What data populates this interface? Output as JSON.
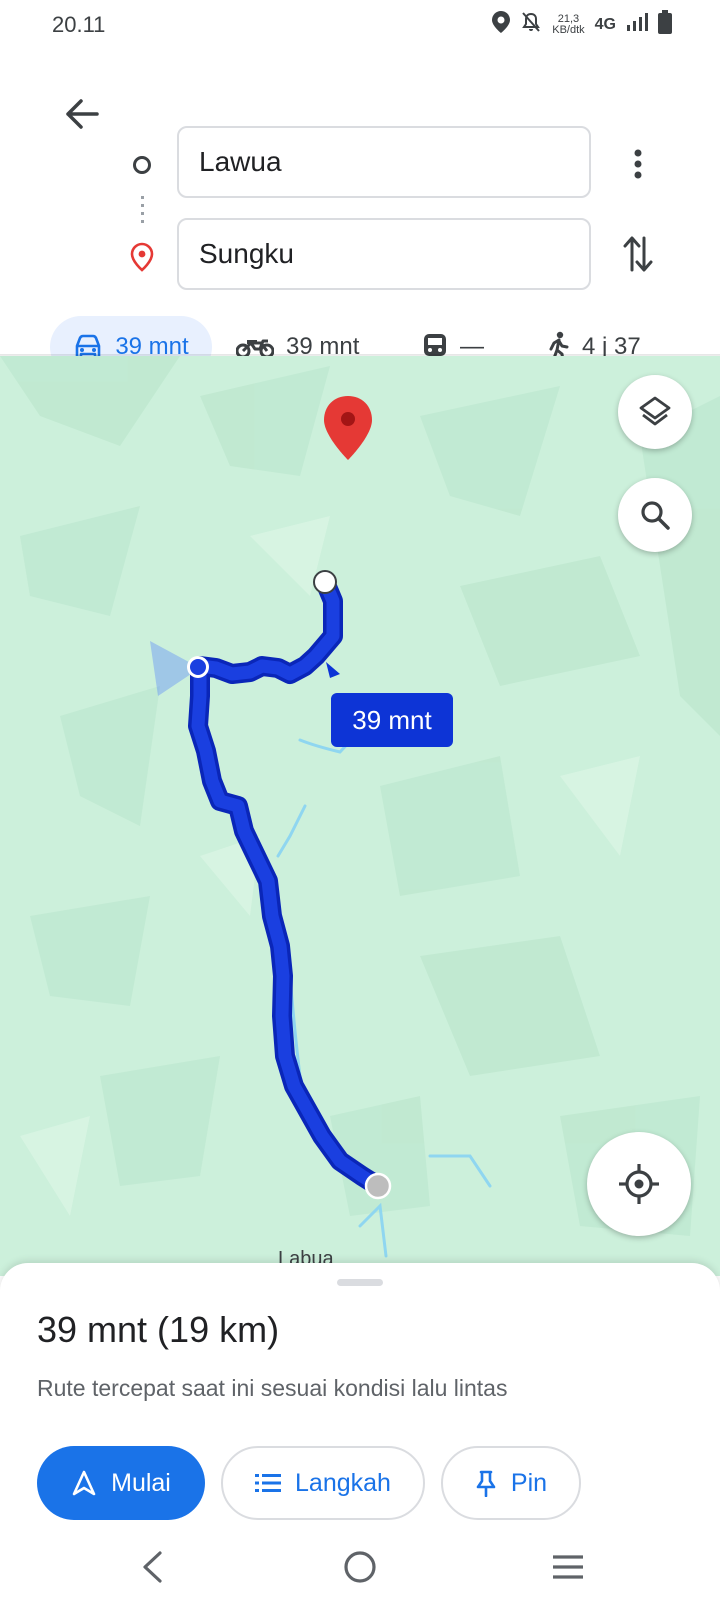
{
  "status_bar": {
    "time": "20.11",
    "speed_value": "21,3",
    "speed_unit": "KB/dtk",
    "network": "4G",
    "icons": [
      "location-icon",
      "mute-icon",
      "signal-icon",
      "battery-icon"
    ]
  },
  "directions": {
    "origin": "Lawua",
    "destination": "Sungku",
    "icons": [
      "back-arrow-icon",
      "origin-circle-icon",
      "destination-pin-icon",
      "more-vert-icon",
      "swap-icon"
    ]
  },
  "modes": [
    {
      "name": "car",
      "label": "39 mnt",
      "selected": true,
      "icon": "car-icon"
    },
    {
      "name": "motorcycle",
      "label": "39 mnt",
      "selected": false,
      "icon": "motorcycle-icon"
    },
    {
      "name": "transit",
      "label": "—",
      "selected": false,
      "icon": "train-icon"
    },
    {
      "name": "walk",
      "label": "4 j 37",
      "selected": false,
      "icon": "walk-icon"
    }
  ],
  "map": {
    "route_label": "39 mnt",
    "town_label": "Labua",
    "controls": [
      "layers-icon",
      "search-icon",
      "my-location-icon"
    ]
  },
  "summary": {
    "title": "39 mnt (19 km)",
    "subtitle": "Rute tercepat saat ini sesuai kondisi lalu lintas",
    "buttons": {
      "start": "Mulai",
      "steps": "Langkah",
      "pin": "Pin"
    }
  },
  "nav_bar": {
    "icons": [
      "nav-back-icon",
      "nav-home-icon",
      "nav-menu-icon"
    ]
  },
  "colors": {
    "accent": "#1a73e8",
    "route": "#1a3fe0",
    "route_label_bg": "#0d34d6",
    "map_bg": "#ccf0db",
    "pin_red": "#e53935"
  }
}
